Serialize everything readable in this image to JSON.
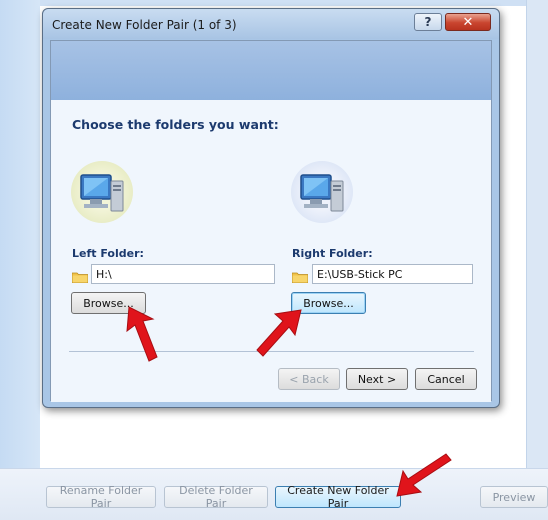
{
  "dialog": {
    "title": "Create New Folder Pair (1 of 3)",
    "help_label": "?",
    "close_label": "✕",
    "heading": "Choose the folders you want:",
    "left": {
      "label": "Left Folder:",
      "path": "H:\\",
      "browse_label": "Browse..."
    },
    "right": {
      "label": "Right Folder:",
      "path": "E:\\USB-Stick PC",
      "browse_label": "Browse..."
    },
    "buttons": {
      "back": "< Back",
      "next": "Next >",
      "cancel": "Cancel"
    }
  },
  "toolbar": {
    "rename": "Rename Folder Pair",
    "delete": "Delete Folder Pair",
    "create": "Create New Folder Pair",
    "preview": "Preview"
  },
  "icons": {
    "computer": "computer-icon",
    "folder": "folder-icon",
    "arrow": "red-arrow-icon"
  },
  "colors": {
    "accent": "#1c3a6e",
    "arrow": "#e0141b",
    "header_band": "#8eb1dd"
  }
}
